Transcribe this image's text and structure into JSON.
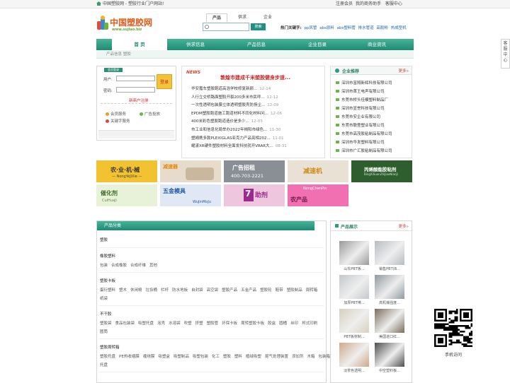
{
  "topbar": {
    "site": "中国塑胶网 - 塑胶行业门户网站!",
    "links": [
      "注册会员",
      "我的商务助手",
      "客服中心"
    ]
  },
  "logo": {
    "cn": "中国塑胶网",
    "url": "www.sujiao.biz"
  },
  "search": {
    "tabs": [
      "产品",
      "供求",
      "企业"
    ],
    "active_tab": "产品",
    "placeholder": "",
    "button": "搜索",
    "hot_label": "热门关键字:",
    "hot_keywords": [
      "pp风管",
      "abs原料",
      "abs塑料管",
      "排水管道",
      "高胶粉",
      "热成型机"
    ]
  },
  "nav": {
    "items": [
      "首 页",
      "供求信息",
      "产品信息",
      "企业目录",
      "商业资讯"
    ],
    "active": "首 页"
  },
  "breadcrumb": "产品信息  塑胶",
  "side_tab": "客服中心",
  "login": {
    "tag": "会员登录",
    "user_label": "用户:",
    "pass_label": "密码:",
    "button": "登录",
    "register": "新商户注册",
    "services": [
      "会员服务",
      "广告投放",
      "关键字服务"
    ],
    "service_colors": [
      "#e8a11a",
      "#6bb84a",
      "#d44a4a"
    ]
  },
  "news": {
    "badge": "NEWS",
    "headline": "敦煌市建成千米塑胶健身步道...",
    "items": [
      {
        "t": "华安嘉车塑胶跑道高浩学校修复新颜...",
        "d": "12-14"
      },
      {
        "t": "人行立交桥路面塑胶开裂200多米市民呼...",
        "d": "12-12"
      },
      {
        "t": "一次性透明包装膜立体透明塑胶壳防扬尘...",
        "d": "12-09"
      },
      {
        "t": "EPDM塑胶跑道施工跑道材料不同化材料问...",
        "d": "12-06"
      },
      {
        "t": "400米彩色塑胶跑道造价是多少...",
        "d": "12-03"
      },
      {
        "t": "市工业和信息化局举办2022年揭阳市绿色...",
        "d": "11-30"
      },
      {
        "t": "塑姆携多款PLEXIGLAS亚克力产品亮相202...",
        "d": "11-01"
      },
      {
        "t": "耀漾XR硬件塑胶材料全面发科技就开VRAR大...",
        "d": "08-31"
      }
    ]
  },
  "enterprise": {
    "title": "企业推荐",
    "more": "更多»",
    "items": [
      "深圳市富翔新辉科技有限公司",
      "深圳市首王电声有限公司",
      "东莞市桥头佳模塑料制品厂",
      "深圳市显誉科技有限公司",
      "东莞市安企业有限公司",
      "东莞市联登塑业有限公司",
      "东莞市高茂胶粘制品有限公司",
      "深圳市华发塑料有限公司",
      "深圳市广汇胶粘制品有限公司"
    ]
  },
  "banners": [
    {
      "t": "农·业·机·械",
      "s": "— NongYeJiXie —"
    },
    {
      "t": "减速器",
      "s": ""
    },
    {
      "t": "广告招租",
      "s": "400-703-2221"
    },
    {
      "t": "减速机",
      "s": ""
    },
    {
      "t": "丙烯酸酯胶粘剂",
      "s": "BingXiSuanZhiJiaoNianJi"
    },
    {
      "t": "催化剂",
      "s": "CuiHuaJi"
    },
    {
      "t": "五金模具",
      "s": "WuJinMoJu"
    },
    {
      "t": "助剂",
      "s": ""
    },
    {
      "t": "农产品",
      "s": "NongChanPin"
    }
  ],
  "categories": {
    "title": "产品分类",
    "groups": [
      {
        "name": "塑胶",
        "subs": []
      },
      {
        "name": "橡胶塑料",
        "subs": [
          "包装",
          "合成橡胶",
          "合成纤维",
          "其他"
        ]
      },
      {
        "name": "塑胶卡板",
        "subs": [
          "蛋衍塑料",
          "塑木",
          "休闲椅",
          "垃圾桶",
          "栏杆",
          "防水地板",
          "自封袋",
          "高空袋",
          "塑胶产品",
          "五金产品",
          "塑胶轮",
          "鞋带",
          "塑胶制品",
          "周转箱",
          "纸袋"
        ]
      },
      {
        "name": "不干胶",
        "subs": [
          "塑胶袋",
          "食品包装袋",
          "吸塑托盘",
          "泡壳",
          "水溶袋",
          "吹塑",
          "挤塑",
          "塑胶管",
          "环保卡板",
          "周转塑胶卡板",
          "胶盒",
          "圆桶",
          "丝印",
          "柯式印刷",
          "圆筒"
        ]
      },
      {
        "name": "塑胶周转箱",
        "subs": [
          "塑胶托盘",
          "PE热收缩膜",
          "缠绕膜",
          "吸塑盒",
          "吸塑制品",
          "吸塑包装",
          "化工",
          "塑胶",
          "塑料",
          "植绒吸塑",
          "尾气处理装置",
          "添加剂",
          "木箱",
          "包装箱",
          "托盘"
        ]
      }
    ]
  },
  "products": {
    "title": "产品展示",
    "more": "更多»",
    "items": [
      "山东PBT板...",
      "销售PBT(B...",
      "加厚PBT棒...",
      "高机械强度...",
      "PBT板材制...",
      "美国进口红...",
      "淡茶色透明...",
      "中空塑料板..."
    ]
  },
  "qr": {
    "caption": "手机访问"
  }
}
